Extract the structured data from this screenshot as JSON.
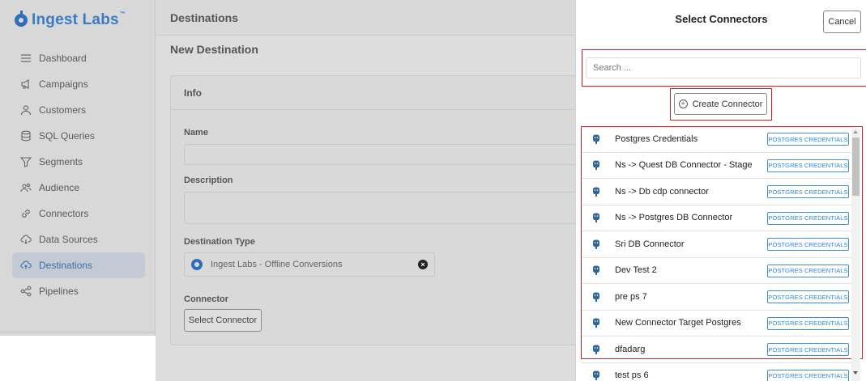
{
  "sidebar": {
    "logo_text": "Ingest Labs",
    "logo_tm": "™",
    "items": [
      {
        "label": "Dashboard",
        "icon": "list-icon"
      },
      {
        "label": "Campaigns",
        "icon": "megaphone-icon"
      },
      {
        "label": "Customers",
        "icon": "user-icon"
      },
      {
        "label": "SQL Queries",
        "icon": "database-icon"
      },
      {
        "label": "Segments",
        "icon": "funnel-icon"
      },
      {
        "label": "Audience",
        "icon": "users-icon"
      },
      {
        "label": "Connectors",
        "icon": "link-icon"
      },
      {
        "label": "Data Sources",
        "icon": "cloud-download-icon"
      },
      {
        "label": "Destinations",
        "icon": "cloud-upload-icon",
        "active": true
      },
      {
        "label": "Pipelines",
        "icon": "share-icon"
      }
    ]
  },
  "header": {
    "title": "Destinations"
  },
  "main": {
    "page_title": "New Destination",
    "card_title": "Info",
    "name_label": "Name",
    "description_label": "Description",
    "destination_type_label": "Destination Type",
    "destination_type_value": "Ingest Labs - Offline Conversions",
    "connector_label": "Connector",
    "select_connector_label": "Select Connector"
  },
  "panel": {
    "title": "Select Connectors",
    "cancel_label": "Cancel",
    "search_placeholder": "Search ...",
    "create_label": "Create Connector",
    "connectors": [
      {
        "name": "Postgres Credentials",
        "badge": "POSTGRES CREDENTIALS"
      },
      {
        "name": "Ns -> Quest DB Connector - Stage",
        "badge": "POSTGRES CREDENTIALS"
      },
      {
        "name": "Ns -> Db cdp connector",
        "badge": "POSTGRES CREDENTIALS"
      },
      {
        "name": "Ns -> Postgres DB Connector",
        "badge": "POSTGRES CREDENTIALS"
      },
      {
        "name": "Sri DB Connector",
        "badge": "POSTGRES CREDENTIALS"
      },
      {
        "name": "Dev Test 2",
        "badge": "POSTGRES CREDENTIALS"
      },
      {
        "name": "pre ps 7",
        "badge": "POSTGRES CREDENTIALS"
      },
      {
        "name": "New Connector Target Postgres",
        "badge": "POSTGRES CREDENTIALS"
      },
      {
        "name": "dfadarg",
        "badge": "POSTGRES CREDENTIALS"
      },
      {
        "name": "test ps 6",
        "badge": "POSTGRES CREDENTIALS"
      }
    ]
  },
  "colors": {
    "accent": "#3a7cc4",
    "highlight": "#cc2222",
    "badge": "#2e86d6"
  }
}
